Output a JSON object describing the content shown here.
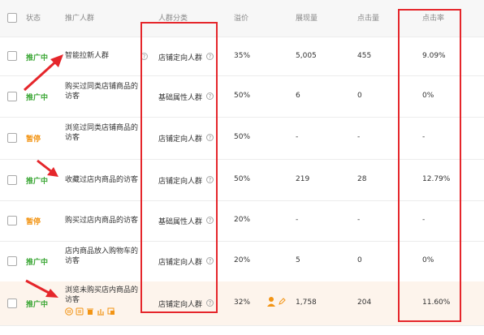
{
  "columns": {
    "status": "状态",
    "name": "推广人群",
    "category": "人群分类",
    "premium": "溢价",
    "impressions": "展现量",
    "clicks": "点击量",
    "ctr": "点击率"
  },
  "status_colors": {
    "推广中": "#3aa634",
    "暂停": "#f29414"
  },
  "rows": [
    {
      "status": "推广中",
      "name": "智能拉新人群",
      "category": "店铺定向人群",
      "premium": "35%",
      "impressions": "5,005",
      "clicks": "455",
      "ctr": "9.09%"
    },
    {
      "status": "推广中",
      "name": "购买过同类店铺商品的访客",
      "category": "基础属性人群",
      "premium": "50%",
      "impressions": "6",
      "clicks": "0",
      "ctr": "0%"
    },
    {
      "status": "暂停",
      "name": "浏览过同类店铺商品的访客",
      "category": "店铺定向人群",
      "premium": "50%",
      "impressions": "-",
      "clicks": "-",
      "ctr": "-"
    },
    {
      "status": "推广中",
      "name": "收藏过店内商品的访客",
      "category": "店铺定向人群",
      "premium": "50%",
      "impressions": "219",
      "clicks": "28",
      "ctr": "12.79%"
    },
    {
      "status": "暂停",
      "name": "购买过店内商品的访客",
      "category": "基础属性人群",
      "premium": "20%",
      "impressions": "-",
      "clicks": "-",
      "ctr": "-"
    },
    {
      "status": "推广中",
      "name": "店内商品放入购物车的访客",
      "category": "店铺定向人群",
      "premium": "20%",
      "impressions": "5",
      "clicks": "0",
      "ctr": "0%"
    },
    {
      "status": "推广中",
      "name": "浏览未购买店内商品的访客",
      "category": "店铺定向人群",
      "premium": "32%",
      "impressions": "1,758",
      "clicks": "204",
      "ctr": "11.60%"
    }
  ],
  "help_glyph": "?",
  "icons": [
    "pause-icon",
    "edit-icon",
    "delete-icon",
    "chart-icon",
    "report-icon",
    "person-icon",
    "pencil-icon",
    "arrow-annotation"
  ],
  "annotation_color": "#e5262b"
}
